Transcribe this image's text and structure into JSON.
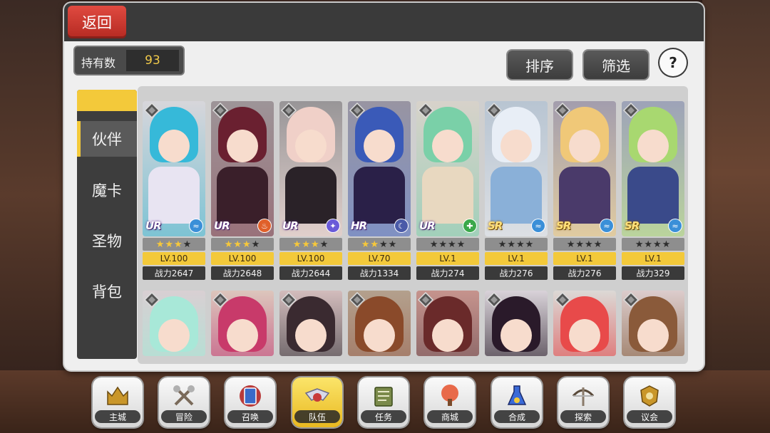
{
  "header": {
    "back_label": "返回"
  },
  "count": {
    "label": "持有数",
    "value": "93"
  },
  "toolbar": {
    "sort_label": "排序",
    "filter_label": "筛选",
    "help_label": "?"
  },
  "side_tabs": [
    {
      "label": "伙伴",
      "active": true
    },
    {
      "label": "魔卡",
      "active": false
    },
    {
      "label": "圣物",
      "active": false
    },
    {
      "label": "背包",
      "active": false
    }
  ],
  "cards_row1": [
    {
      "rarity": "UR",
      "element": "water-icon",
      "stars": 3,
      "level": "LV.100",
      "power": "战力2647",
      "hair": "#36b9d9",
      "outfit": "#e8e4f2",
      "elem_color": "#3a8fd8"
    },
    {
      "rarity": "UR",
      "element": "fire-icon",
      "stars": 3,
      "level": "LV.100",
      "power": "战力2648",
      "hair": "#6a2030",
      "outfit": "#3a1f2a",
      "elem_color": "#e0602a"
    },
    {
      "rarity": "UR",
      "element": "wind-icon",
      "stars": 3,
      "level": "LV.100",
      "power": "战力2644",
      "hair": "#f0d0c8",
      "outfit": "#2a2228",
      "elem_color": "#6a5ad8"
    },
    {
      "rarity": "HR",
      "element": "dark-icon",
      "stars": 2,
      "level": "LV.70",
      "power": "战力1334",
      "hair": "#3a5ab8",
      "outfit": "#2a2048",
      "elem_color": "#4a5aa8"
    },
    {
      "rarity": "UR",
      "element": "earth-icon",
      "stars": 0,
      "level": "LV.1",
      "power": "战力274",
      "hair": "#7ad0a8",
      "outfit": "#e8d8c0",
      "elem_color": "#3aa84a"
    },
    {
      "rarity": "SR",
      "element": "water-icon",
      "stars": 0,
      "level": "LV.1",
      "power": "战力276",
      "hair": "#e8eef6",
      "outfit": "#8ab0d8",
      "elem_color": "#3a8fd8"
    },
    {
      "rarity": "SR",
      "element": "water-icon",
      "stars": 0,
      "level": "LV.1",
      "power": "战力276",
      "hair": "#f0c878",
      "outfit": "#4a3a6a",
      "elem_color": "#3a8fd8"
    },
    {
      "rarity": "SR",
      "element": "water-icon",
      "stars": 0,
      "level": "LV.1",
      "power": "战力329",
      "hair": "#a8d870",
      "outfit": "#3a4a8a",
      "elem_color": "#3a8fd8"
    }
  ],
  "cards_row2": [
    {
      "hair": "#a8e8d8",
      "outfit": "#e8d0d8"
    },
    {
      "hair": "#c83a6a",
      "outfit": "#f0b8a0"
    },
    {
      "hair": "#3a2a30",
      "outfit": "#d8a0a0"
    },
    {
      "hair": "#8a4a2a",
      "outfit": "#8a5a2a"
    },
    {
      "hair": "#6a2a2a",
      "outfit": "#b83a2a"
    },
    {
      "hair": "#2a1a2a",
      "outfit": "#e8d8e8"
    },
    {
      "hair": "#e84a4a",
      "outfit": "#f0e8e0"
    },
    {
      "hair": "#8a5a3a",
      "outfit": "#f0c8c8"
    }
  ],
  "nav": [
    {
      "label": "主城",
      "icon": "castle-crown-icon",
      "active": false
    },
    {
      "label": "冒险",
      "icon": "crossed-axes-icon",
      "active": false
    },
    {
      "label": "召唤",
      "icon": "summon-card-icon",
      "active": false
    },
    {
      "label": "队伍",
      "icon": "winged-emblem-icon",
      "active": true
    },
    {
      "label": "任务",
      "icon": "quest-book-icon",
      "active": false
    },
    {
      "label": "商城",
      "icon": "shop-tree-icon",
      "active": false
    },
    {
      "label": "合成",
      "icon": "potion-flask-icon",
      "active": false
    },
    {
      "label": "探索",
      "icon": "crossbow-icon",
      "active": false
    },
    {
      "label": "议会",
      "icon": "council-crest-icon",
      "active": false
    }
  ]
}
